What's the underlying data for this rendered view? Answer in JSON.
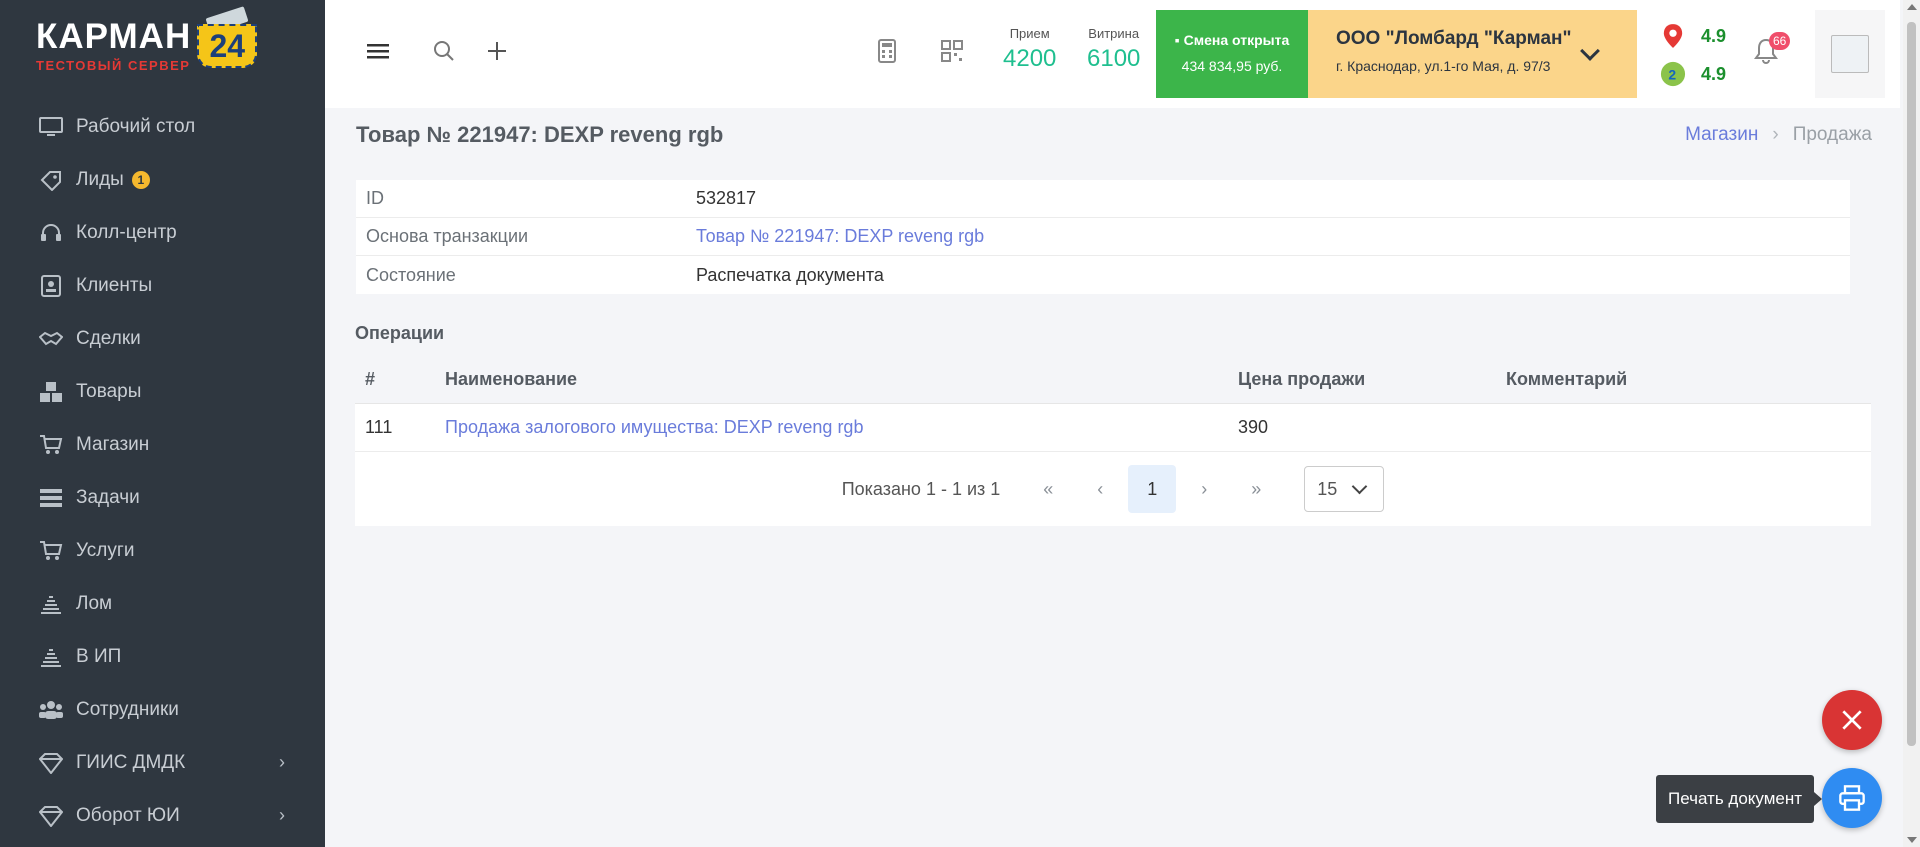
{
  "logo": {
    "word": "КАРМАН",
    "number": "24",
    "subtitle": "ТЕСТОВЫЙ СЕРВЕР"
  },
  "sidebar": {
    "items": [
      {
        "label": "Рабочий стол",
        "icon": "monitor-icon"
      },
      {
        "label": "Лиды",
        "icon": "tag-icon",
        "badge": "1"
      },
      {
        "label": "Колл-центр",
        "icon": "headset-icon"
      },
      {
        "label": "Клиенты",
        "icon": "contact-card-icon"
      },
      {
        "label": "Сделки",
        "icon": "handshake-icon"
      },
      {
        "label": "Товары",
        "icon": "boxes-icon"
      },
      {
        "label": "Магазин",
        "icon": "cart-icon"
      },
      {
        "label": "Задачи",
        "icon": "tasks-icon"
      },
      {
        "label": "Услуги",
        "icon": "cart-icon"
      },
      {
        "label": "Лом",
        "icon": "stack-icon"
      },
      {
        "label": "В ИП",
        "icon": "stack-icon"
      },
      {
        "label": "Сотрудники",
        "icon": "users-icon"
      },
      {
        "label": "ГИИС ДМДК",
        "icon": "diamond-icon",
        "has_children": true
      },
      {
        "label": "Оборот ЮИ",
        "icon": "diamond-icon",
        "has_children": true
      }
    ]
  },
  "header": {
    "stats": [
      {
        "label": "Прием",
        "value": "4200"
      },
      {
        "label": "Витрина",
        "value": "6100"
      }
    ],
    "shift": {
      "status": "Смена открыта",
      "amount": "434 834,95 руб."
    },
    "org": {
      "name": "ООО \"Ломбард \"Карман\"",
      "address": "г. Краснодар, ул.1-го Мая, д. 97/3"
    },
    "ratings": [
      {
        "icon": "map-pin-icon",
        "value": "4.9"
      },
      {
        "icon": "2gis-icon",
        "value": "4.9"
      }
    ],
    "notifications_count": "66"
  },
  "page": {
    "title": "Товар № 221947: DEXP reveng rgb",
    "breadcrumbs": [
      "Магазин",
      "Продажа"
    ],
    "details": [
      {
        "key": "ID",
        "value": "532817",
        "link": false
      },
      {
        "key": "Основа транзакции",
        "value": "Товар № 221947: DEXP reveng rgb",
        "link": true
      },
      {
        "key": "Состояние",
        "value": "Распечатка документа",
        "link": false
      }
    ],
    "operations_title": "Операции",
    "table": {
      "headers": [
        "#",
        "Наименование",
        "Цена продажи",
        "Комментарий"
      ],
      "rows": [
        [
          "111",
          "Продажа залогового имущества: DEXP reveng rgb",
          "390",
          ""
        ]
      ]
    },
    "pagination": {
      "summary": "Показано 1 - 1 из 1",
      "current_page": "1",
      "page_size": "15"
    }
  },
  "fab": {
    "print_tooltip": "Печать документ"
  },
  "colors": {
    "sidebar_bg": "#2f3740",
    "accent_green": "#1fbf8f",
    "shift_green": "#3cb54a",
    "org_yellow": "#fbd58a",
    "link": "#6a7cdb",
    "close_red": "#d93434",
    "print_blue": "#2f8cf2"
  }
}
